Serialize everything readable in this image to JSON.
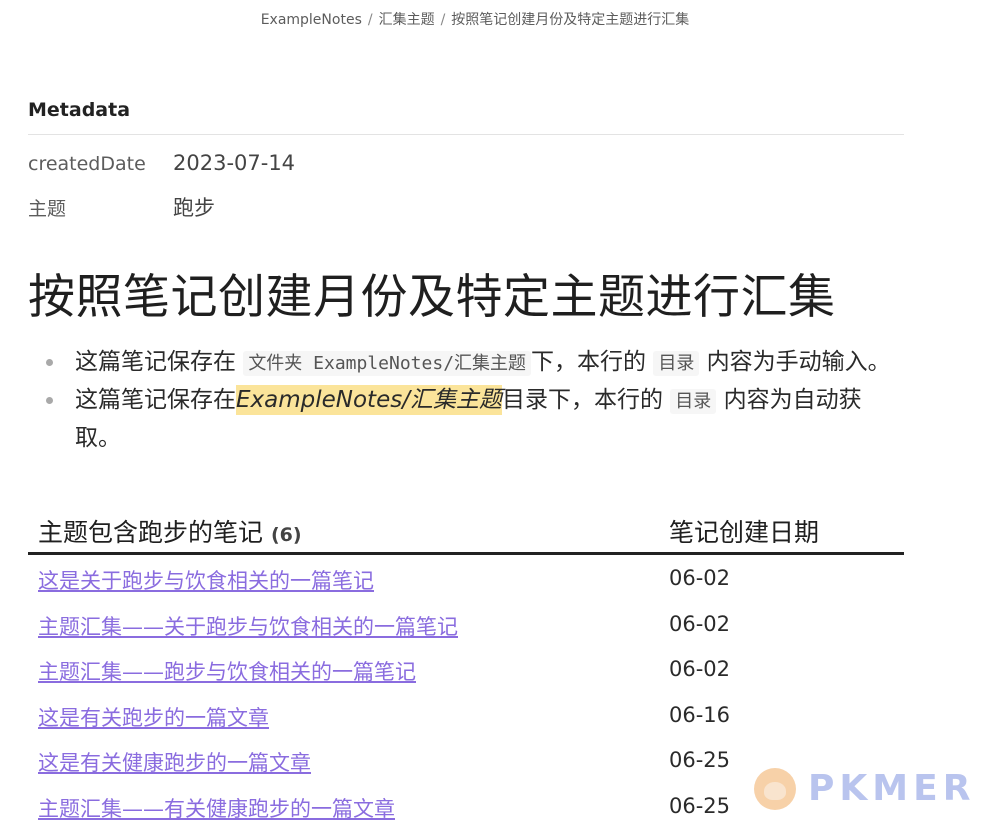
{
  "breadcrumb": {
    "items": [
      "ExampleNotes",
      "汇集主题",
      "按照笔记创建月份及特定主题进行汇集"
    ],
    "separator": "/"
  },
  "metadata": {
    "title": "Metadata",
    "rows": [
      {
        "key": "createdDate",
        "value": "2023-07-14"
      },
      {
        "key": "主题",
        "value": "跑步"
      }
    ]
  },
  "page": {
    "title": "按照笔记创建月份及特定主题进行汇集",
    "bullets": [
      {
        "prefix": "这篇笔记保存在",
        "code": "文件夹 ExampleNotes/汇集主题",
        "middle": "下，本行的",
        "code2": "目录",
        "suffix": "内容为手动输入。"
      },
      {
        "prefix": "这篇笔记保存在",
        "highlight": "ExampleNotes/汇集主题",
        "middle": "目录下，本行的",
        "code2": "目录",
        "suffix": "内容为自动获取。"
      }
    ]
  },
  "table": {
    "col1_header": "主题包含跑步的笔记",
    "col1_count": "(6)",
    "col2_header": "笔记创建日期",
    "rows": [
      {
        "title": "这是关于跑步与饮食相关的一篇笔记",
        "date": "06-02"
      },
      {
        "title": "主题汇集——关于跑步与饮食相关的一篇笔记",
        "date": "06-02"
      },
      {
        "title": "主题汇集——跑步与饮食相关的一篇笔记",
        "date": "06-02"
      },
      {
        "title": "这是有关跑步的一篇文章",
        "date": "06-16"
      },
      {
        "title": "这是有关健康跑步的一篇文章",
        "date": "06-25"
      },
      {
        "title": "主题汇集——有关健康跑步的一篇文章",
        "date": "06-25"
      }
    ]
  },
  "watermark": {
    "text": "PKMER"
  },
  "colors": {
    "link": "#8a6cdf",
    "highlight": "#fbe49a",
    "watermark_text": "#b9c4ee"
  }
}
